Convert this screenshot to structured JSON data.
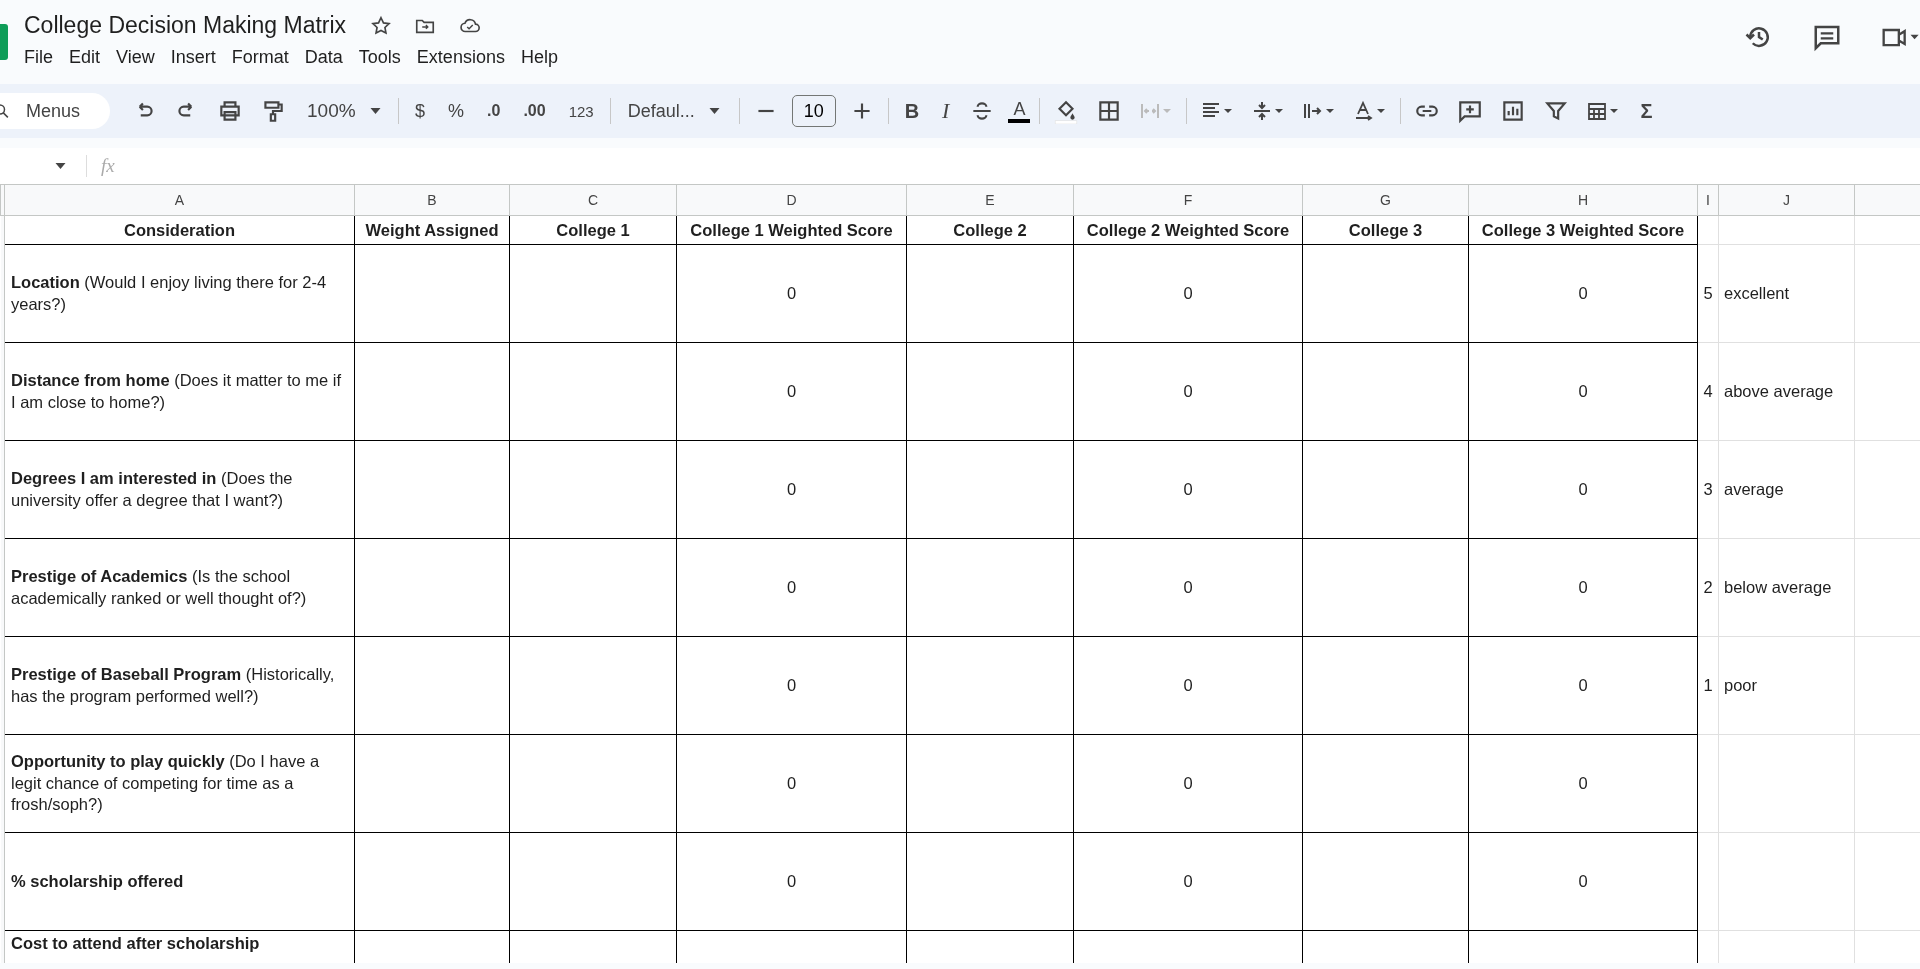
{
  "document": {
    "title": "College Decision Making Matrix"
  },
  "menu": [
    "File",
    "Edit",
    "View",
    "Insert",
    "Format",
    "Data",
    "Tools",
    "Extensions",
    "Help"
  ],
  "toolbar": {
    "search_placeholder": "Menus",
    "zoom": "100%",
    "currency": "$",
    "percent": "%",
    "decrease_decimal": ".0",
    "increase_decimal": ".00",
    "number_format": "123",
    "font": "Defaul...",
    "font_size": "10",
    "bold": "B",
    "italic": "I",
    "text_color": "A",
    "sum": "Σ"
  },
  "formula_bar": {
    "fx": "fx"
  },
  "sheet": {
    "column_letters": [
      "A",
      "B",
      "C",
      "D",
      "E",
      "F",
      "G",
      "H",
      "I",
      "J"
    ],
    "header": [
      "Consideration",
      "Weight Assigned",
      "College 1",
      "College 1 Weighted Score",
      "College 2",
      "College 2 Weighted Score",
      "College 3",
      "College 3 Weighted Score"
    ],
    "rows": [
      {
        "consideration": "**Location** (Would I enjoy living there for 2-4 years?)",
        "scores": [
          "0",
          "0",
          "0"
        ],
        "scale_number": "5",
        "scale_label": "excellent"
      },
      {
        "consideration": "**Distance from home** (Does it matter to me if I am close to home?)",
        "scores": [
          "0",
          "0",
          "0"
        ],
        "scale_number": "4",
        "scale_label": "above average"
      },
      {
        "consideration": "**Degrees I am interested in** (Does the university offer a degree that I want?)",
        "scores": [
          "0",
          "0",
          "0"
        ],
        "scale_number": "3",
        "scale_label": "average"
      },
      {
        "consideration": "**Prestige of Academics** (Is the school academically ranked or well thought of?)",
        "scores": [
          "0",
          "0",
          "0"
        ],
        "scale_number": "2",
        "scale_label": "below average"
      },
      {
        "consideration": "**Prestige of Baseball Program** (Historically, has the program performed well?)",
        "scores": [
          "0",
          "0",
          "0"
        ],
        "scale_number": "1",
        "scale_label": "poor"
      },
      {
        "consideration": "**Opportunity to play quickly** (Do I have a legit chance of competing for time as a frosh/soph?)",
        "scores": [
          "0",
          "0",
          "0"
        ]
      },
      {
        "consideration": "**% scholarship offered**",
        "scores": [
          "0",
          "0",
          "0"
        ]
      },
      {
        "consideration": "**Cost to attend after scholarship**"
      }
    ]
  }
}
